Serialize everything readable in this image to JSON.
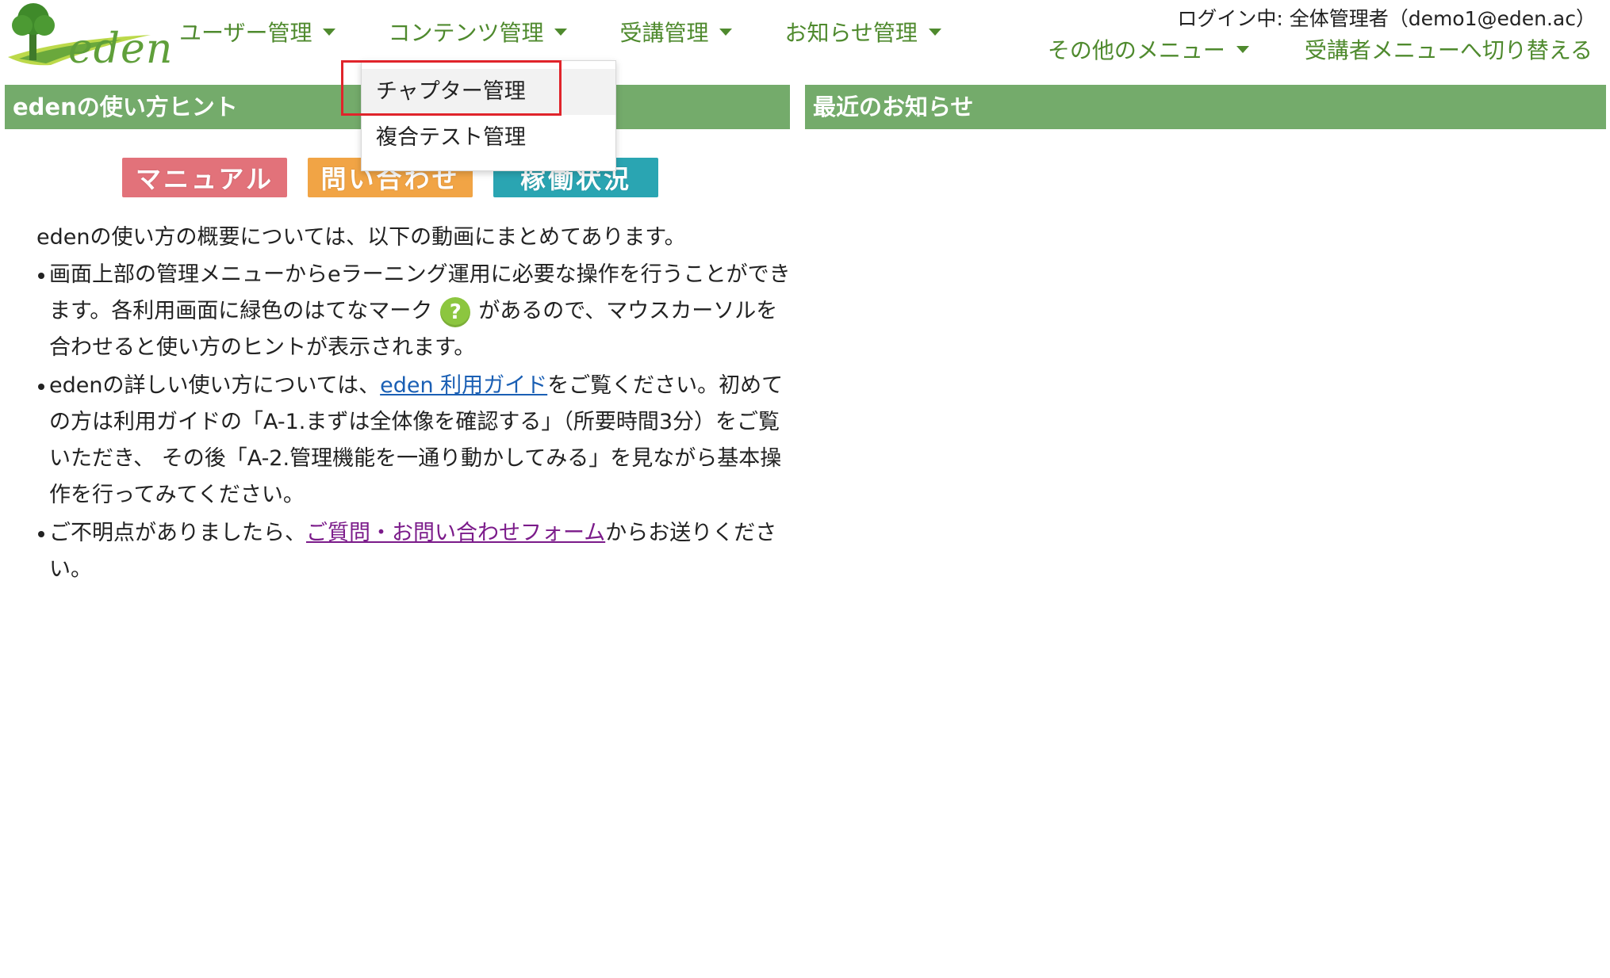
{
  "logo": {
    "text": "eden"
  },
  "nav": {
    "items": [
      {
        "label": "ユーザー管理"
      },
      {
        "label": "コンテンツ管理"
      },
      {
        "label": "受講管理"
      },
      {
        "label": "お知らせ管理"
      }
    ],
    "login_info": "ログイン中: 全体管理者（demo1@eden.ac）",
    "other_menu": "その他のメニュー",
    "switch_label": "受講者メニューへ切り替える"
  },
  "dropdown": {
    "items": [
      {
        "label": "チャプター管理"
      },
      {
        "label": "複合テスト管理"
      }
    ]
  },
  "left_panel": {
    "title": "edenの使い方ヒント",
    "buttons": {
      "manual": "マニュアル",
      "contact": "問い合わせ",
      "status": "稼働状況"
    },
    "intro": "edenの使い方の概要については、以下の動画にまとめてあります。",
    "bullet1_a": "画面上部の管理メニューからeラーニング運用に必要な操作を行うことができます。各利用画面に緑色のはてなマーク",
    "bullet1_b": "があるので、マウスカーソルを合わせると使い方のヒントが表示されます。",
    "bullet2_a": "edenの詳しい使い方については、",
    "bullet2_link": "eden 利用ガイド",
    "bullet2_b": "をご覧ください。初めての方は利用ガイドの「A-1.まずは全体像を確認する」（所要時間3分）をご覧いただき、 その後「A-2.管理機能を一通り動かしてみる」を見ながら基本操作を行ってみてください。",
    "bullet3_a": "ご不明点がありましたら、",
    "bullet3_link": "ご質問・お問い合わせフォーム",
    "bullet3_b": "からお送りください。"
  },
  "right_panel": {
    "title": "最近のお知らせ"
  },
  "colors": {
    "nav_green": "#4f8a2e",
    "panel_header": "#74ab6b",
    "manual_btn": "#e2727a",
    "contact_btn": "#f1a445",
    "status_btn": "#2aa5b2",
    "highlight": "#e0242b",
    "help_icon": "#8cc63f"
  },
  "icons": {
    "help": "question-circle-icon",
    "logo": "tree-icon"
  }
}
